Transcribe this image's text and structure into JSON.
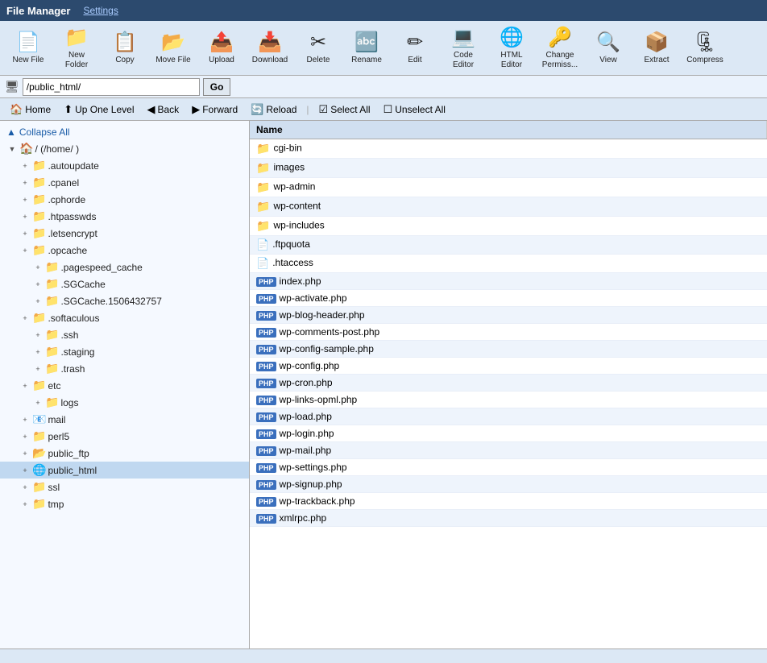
{
  "titleBar": {
    "appTitle": "File Manager",
    "settingsLabel": "Settings"
  },
  "toolbar": {
    "buttons": [
      {
        "id": "new-file",
        "icon": "📄",
        "label": "New File"
      },
      {
        "id": "new-folder",
        "icon": "📁",
        "label": "New\nFolder"
      },
      {
        "id": "copy",
        "icon": "📋",
        "label": "Copy"
      },
      {
        "id": "move-file",
        "icon": "📂",
        "label": "Move File"
      },
      {
        "id": "upload",
        "icon": "📤",
        "label": "Upload"
      },
      {
        "id": "download",
        "icon": "📥",
        "label": "Download"
      },
      {
        "id": "delete",
        "icon": "✂",
        "label": "Delete"
      },
      {
        "id": "rename",
        "icon": "🔤",
        "label": "Rename"
      },
      {
        "id": "edit",
        "icon": "✏",
        "label": "Edit"
      },
      {
        "id": "code-editor",
        "icon": "💻",
        "label": "Code\nEditor"
      },
      {
        "id": "html-editor",
        "icon": "🌐",
        "label": "HTML\nEditor"
      },
      {
        "id": "change-perms",
        "icon": "🔑",
        "label": "Change\nPermiss..."
      },
      {
        "id": "view",
        "icon": "🔍",
        "label": "View"
      },
      {
        "id": "extract",
        "icon": "📦",
        "label": "Extract"
      },
      {
        "id": "compress",
        "icon": "🗜",
        "label": "Compress"
      }
    ]
  },
  "addressBar": {
    "icon": "🖥",
    "value": "/public_html/",
    "goLabel": "Go"
  },
  "navBar": {
    "homeLabel": "Home",
    "upOneLevelLabel": "Up One Level",
    "backLabel": "Back",
    "forwardLabel": "Forward",
    "reloadLabel": "Reload",
    "selectAllLabel": "Select All",
    "unselectAllLabel": "Unselect All"
  },
  "sidebar": {
    "collapseAllLabel": "Collapse All",
    "rootLabel": "/ (/home/ )",
    "items": [
      {
        "label": ".autoupdate",
        "indent": 1,
        "expanded": false
      },
      {
        "label": ".cpanel",
        "indent": 1,
        "expanded": false
      },
      {
        "label": ".cphorde",
        "indent": 1,
        "expanded": false
      },
      {
        "label": ".htpasswds",
        "indent": 1,
        "expanded": false
      },
      {
        "label": ".letsencrypt",
        "indent": 1,
        "expanded": false
      },
      {
        "label": ".opcache",
        "indent": 1,
        "expanded": false
      },
      {
        "label": ".pagespeed_cache",
        "indent": 2,
        "expanded": false
      },
      {
        "label": ".SGCache",
        "indent": 2,
        "expanded": false
      },
      {
        "label": ".SGCache.1506432757",
        "indent": 2,
        "expanded": false
      },
      {
        "label": ".softaculous",
        "indent": 1,
        "expanded": false
      },
      {
        "label": ".ssh",
        "indent": 2,
        "expanded": false
      },
      {
        "label": ".staging",
        "indent": 2,
        "expanded": false
      },
      {
        "label": ".trash",
        "indent": 2,
        "expanded": false
      },
      {
        "label": "etc",
        "indent": 1,
        "expanded": false
      },
      {
        "label": "logs",
        "indent": 2,
        "expanded": false
      },
      {
        "label": "mail",
        "indent": 1,
        "expanded": false,
        "specialIcon": "mail"
      },
      {
        "label": "perl5",
        "indent": 1,
        "expanded": false
      },
      {
        "label": "public_ftp",
        "indent": 1,
        "expanded": false,
        "specialIcon": "ftp"
      },
      {
        "label": "public_html",
        "indent": 1,
        "expanded": false,
        "selected": true,
        "specialIcon": "web"
      },
      {
        "label": "ssl",
        "indent": 1,
        "expanded": false
      },
      {
        "label": "tmp",
        "indent": 1,
        "expanded": false
      }
    ]
  },
  "filePanel": {
    "columnHeader": "Name",
    "files": [
      {
        "name": "cgi-bin",
        "type": "folder"
      },
      {
        "name": "images",
        "type": "folder"
      },
      {
        "name": "wp-admin",
        "type": "folder"
      },
      {
        "name": "wp-content",
        "type": "folder"
      },
      {
        "name": "wp-includes",
        "type": "folder"
      },
      {
        "name": ".ftpquota",
        "type": "file"
      },
      {
        "name": ".htaccess",
        "type": "file"
      },
      {
        "name": "index.php",
        "type": "php"
      },
      {
        "name": "wp-activate.php",
        "type": "php"
      },
      {
        "name": "wp-blog-header.php",
        "type": "php"
      },
      {
        "name": "wp-comments-post.php",
        "type": "php"
      },
      {
        "name": "wp-config-sample.php",
        "type": "php"
      },
      {
        "name": "wp-config.php",
        "type": "php"
      },
      {
        "name": "wp-cron.php",
        "type": "php"
      },
      {
        "name": "wp-links-opml.php",
        "type": "php"
      },
      {
        "name": "wp-load.php",
        "type": "php"
      },
      {
        "name": "wp-login.php",
        "type": "php"
      },
      {
        "name": "wp-mail.php",
        "type": "php"
      },
      {
        "name": "wp-settings.php",
        "type": "php"
      },
      {
        "name": "wp-signup.php",
        "type": "php"
      },
      {
        "name": "wp-trackback.php",
        "type": "php"
      },
      {
        "name": "xmlrpc.php",
        "type": "php"
      }
    ]
  },
  "phpBadge": "PHP"
}
